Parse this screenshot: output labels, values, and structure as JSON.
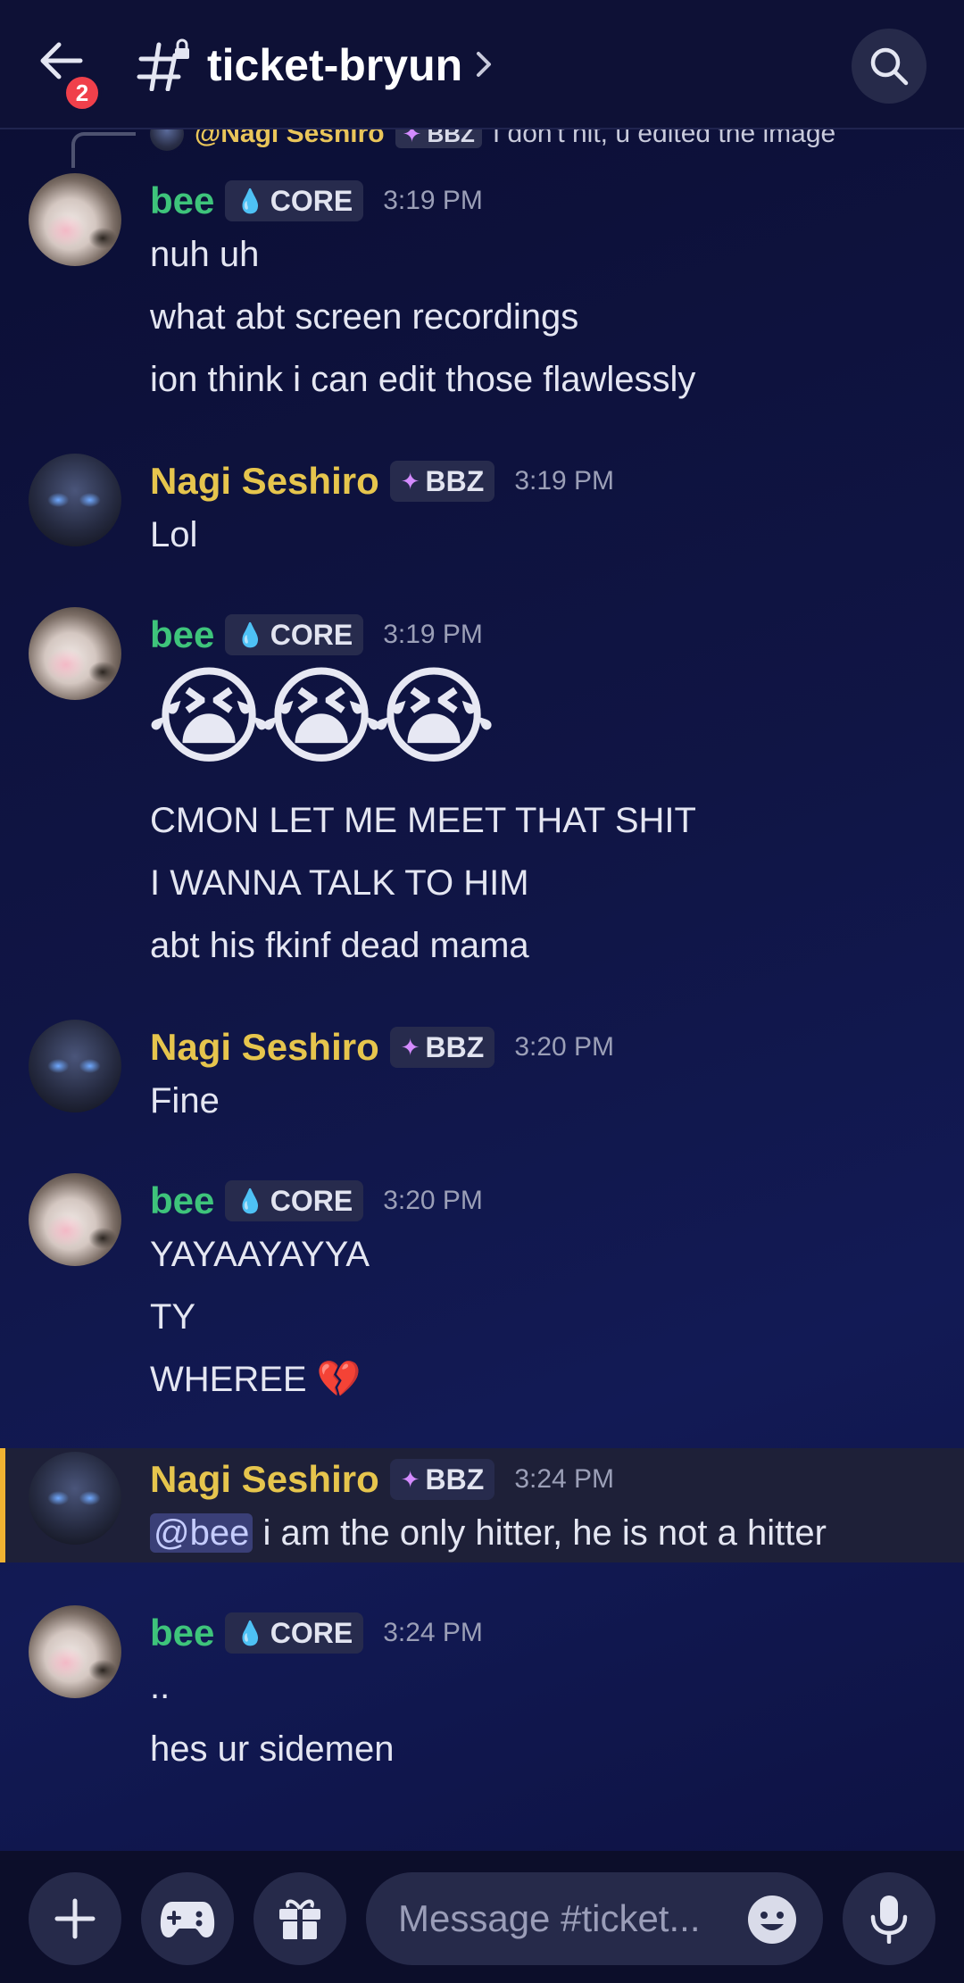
{
  "header": {
    "channel_name": "ticket-bryun",
    "notification_count": "2"
  },
  "reply": {
    "author": "@Nagi Seshiro",
    "tag": "BBZ",
    "text": "I don't hit, u edited the image"
  },
  "messages": [
    {
      "author": "bee",
      "tag": "CORE",
      "time": "3:19 PM",
      "lines": [
        "nuh uh",
        "what abt screen recordings",
        "ion think i can edit those flawlessly"
      ]
    },
    {
      "author": "Nagi Seshiro",
      "tag": "BBZ",
      "time": "3:19 PM",
      "lines": [
        "Lol"
      ]
    },
    {
      "author": "bee",
      "tag": "CORE",
      "time": "3:19 PM",
      "emojis": [
        "😭",
        "😭",
        "😭"
      ],
      "lines": [
        "CMON LET ME MEET THAT SHIT",
        "I WANNA TALK TO HIM",
        "abt his fkinf dead mama"
      ]
    },
    {
      "author": "Nagi Seshiro",
      "tag": "BBZ",
      "time": "3:20 PM",
      "lines": [
        "Fine"
      ]
    },
    {
      "author": "bee",
      "tag": "CORE",
      "time": "3:20 PM",
      "lines": [
        "YAYAAYAYYA",
        "TY",
        "WHEREE"
      ],
      "trailing_emoji": "💔"
    },
    {
      "author": "Nagi Seshiro",
      "tag": "BBZ",
      "time": "3:24 PM",
      "mention": "@bee",
      "lines": [
        "i am the only hitter, he is not a hitter"
      ]
    },
    {
      "author": "bee",
      "tag": "CORE",
      "time": "3:24 PM",
      "lines": [
        "..",
        "hes ur sidemen"
      ]
    }
  ],
  "composer": {
    "placeholder": "Message #ticket..."
  },
  "colors": {
    "bee_name": "#3ec47b",
    "nagi_name": "#e6c54d",
    "mention_highlight": "#f0b232",
    "notification_badge": "#f0404b"
  },
  "icons": [
    "back-arrow-icon",
    "channel-hash-lock-icon",
    "chevron-right-icon",
    "search-icon",
    "plus-icon",
    "gamepad-icon",
    "gift-icon",
    "emoji-icon",
    "microphone-icon"
  ]
}
